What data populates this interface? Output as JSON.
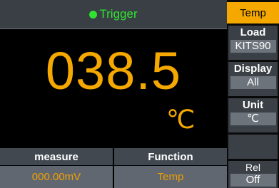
{
  "titlebar": {
    "status": "Trigger"
  },
  "display": {
    "reading": "038.5",
    "unit": "℃"
  },
  "bottom": {
    "measure_label": "measure",
    "measure_value": "000.00mV",
    "function_label": "Function",
    "function_value": "Temp"
  },
  "side": {
    "tab": "Temp",
    "load": {
      "label": "Load",
      "value": "KITS90"
    },
    "display": {
      "label": "Display",
      "value": "All"
    },
    "unit": {
      "label": "Unit",
      "value": "℃"
    },
    "rel": {
      "label": "Rel",
      "value": "Off"
    }
  },
  "colors": {
    "accent": "#f5a800",
    "trigger": "#2fe32f",
    "panel": "#393f45",
    "value_box": "#6c737b"
  }
}
